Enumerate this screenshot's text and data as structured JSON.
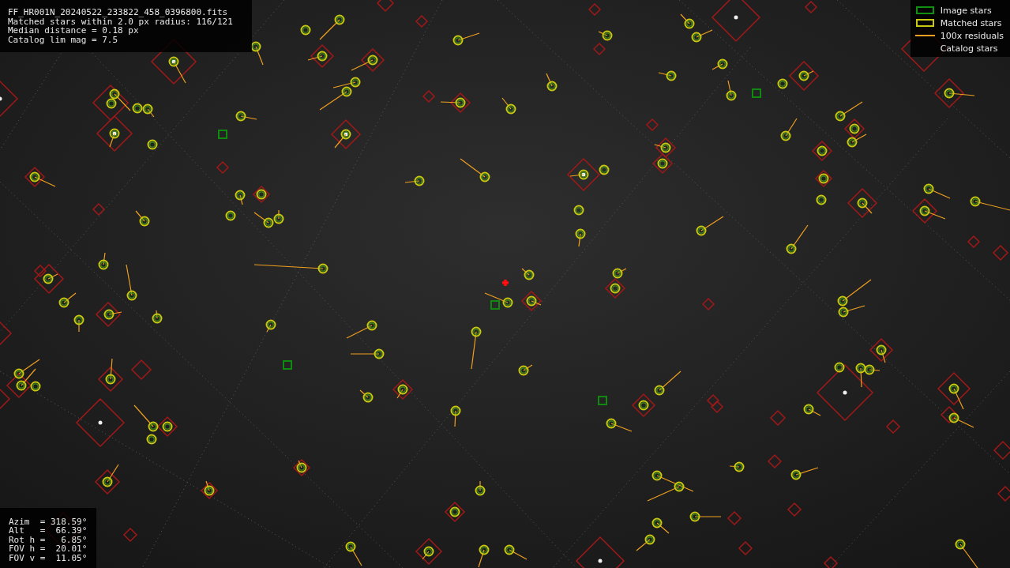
{
  "file_info": {
    "lines": [
      "FF_HR001N_20240522_233822_458_0396800.fits",
      "Matched stars within 2.0 px radius: 116/121",
      "Median distance = 0.18 px",
      "Catalog lim mag = 7.5"
    ]
  },
  "legend": [
    {
      "kind": "image",
      "label": "Image stars"
    },
    {
      "kind": "matched",
      "label": "Matched stars"
    },
    {
      "kind": "residual",
      "label": "100x residuals"
    },
    {
      "label": "Catalog stars"
    }
  ],
  "pointing_info": {
    "lines": [
      "Azim  = 318.59°",
      "Alt   =  66.39°",
      "Rot h =   6.85°",
      "FOV h =  20.01°",
      "FOV v =  11.05°"
    ]
  }
}
